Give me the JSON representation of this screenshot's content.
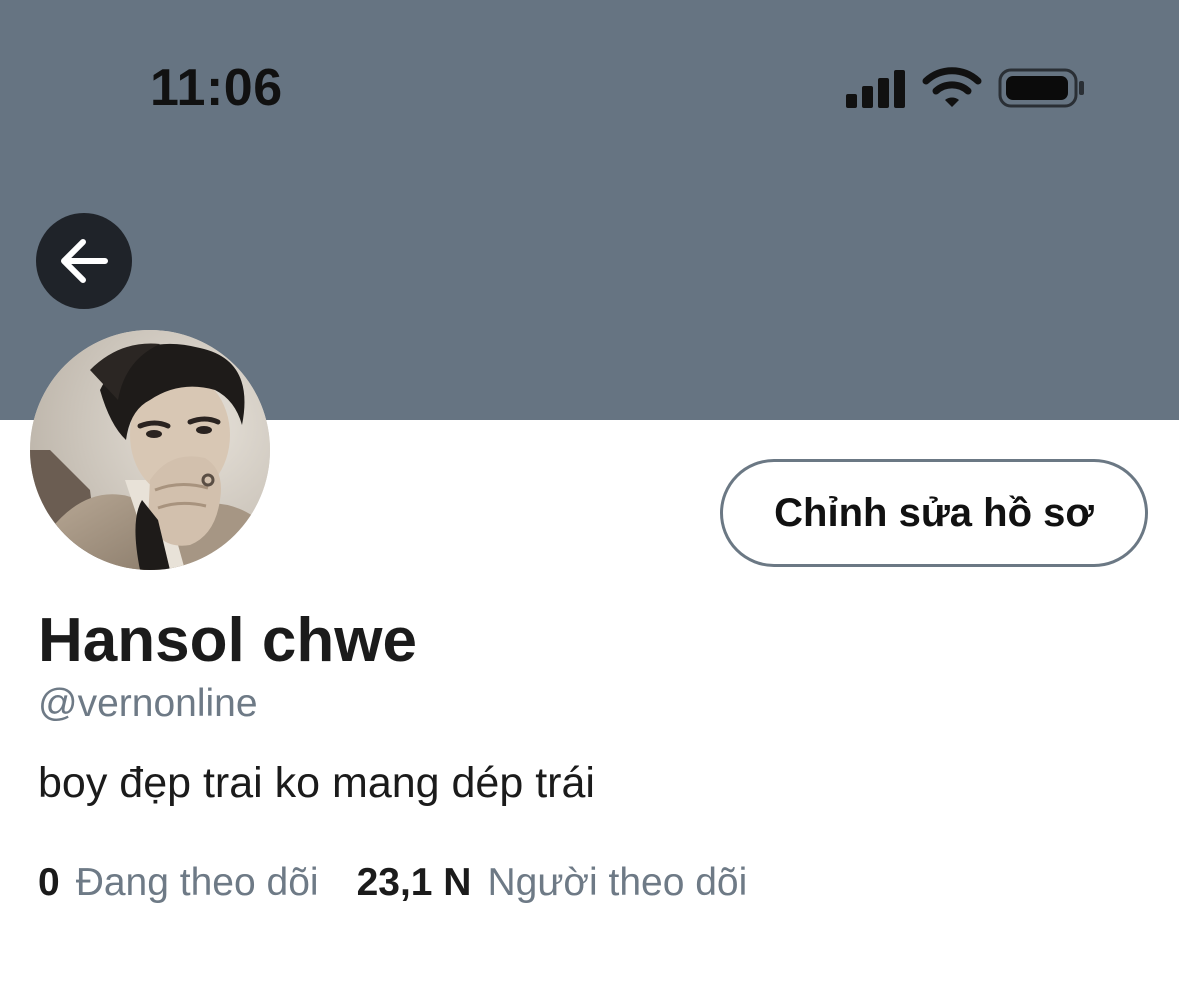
{
  "status_bar": {
    "time": "11:06",
    "icons": [
      "cellular-signal-icon",
      "wifi-icon",
      "battery-icon"
    ]
  },
  "header": {
    "banner_color": "#667482",
    "back_icon": "arrow-left-icon"
  },
  "profile": {
    "edit_button_label": "Chỉnh sửa hồ sơ",
    "display_name": "Hansol chwe",
    "handle": "@vernonline",
    "bio": "boy đẹp trai ko mang dép trái",
    "following_count": "0",
    "following_label": "Đang theo dõi",
    "followers_count": "23,1 N",
    "followers_label": "Người theo dõi"
  },
  "colors": {
    "text_primary": "#1b1b1b",
    "text_secondary": "#6e7a86",
    "button_border": "#6b7884",
    "back_button_bg": "#1f2329"
  }
}
